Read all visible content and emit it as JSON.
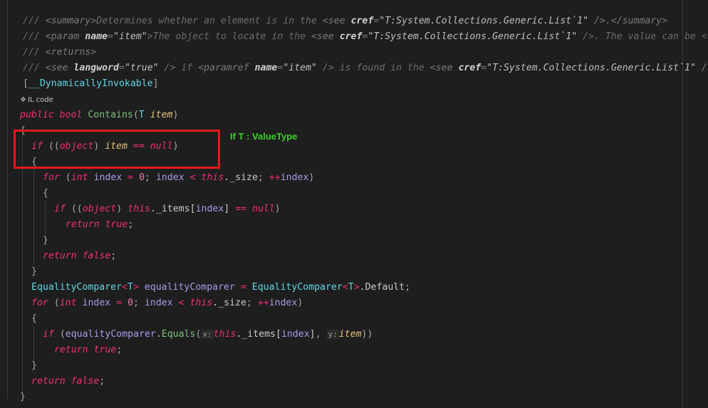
{
  "annotation": {
    "note": "If T : ValueType",
    "box_color": "#e3191b",
    "note_color": "#39d128"
  },
  "meta": {
    "icon": "il-code-icon",
    "label": "IL code"
  },
  "doc": {
    "l1": {
      "slash": "///",
      "open": "<summary>",
      "text": "Determines whether an element is in the ",
      "see": "<see ",
      "cref": "cref",
      "eq": "=",
      "val": "\"T:System.Collections.Generic.List`1\"",
      "close": " />.</summary>"
    },
    "l2": {
      "slash": "///",
      "open": "<param ",
      "name": "name",
      "eq": "=",
      "nameval": "\"item\"",
      "text1": ">The object to locate in the ",
      "see": "<see ",
      "cref": "cref",
      "eq2": "=",
      "val": "\"T:System.Collections.Generic.List`1\"",
      "text2": " />. The value can be <"
    },
    "l3": {
      "slash": "///",
      "open": "<returns>"
    },
    "l4": {
      "slash": "///",
      "see1": "<see ",
      "langword": "langword",
      "eq": "=",
      "langval": "\"true\"",
      "mid": " /> if ",
      "paramref": "<paramref ",
      "name": "name",
      "eq2": "=",
      "nameval": "\"item\"",
      "mid2": " /> is found in the ",
      "see2": "<see ",
      "cref": "cref",
      "eq3": "=",
      "val": "\"T:System.Collections.Generic.List`1\"",
      "end": " /"
    }
  },
  "code": {
    "attr": {
      "open": "[",
      "name": "__DynamicallyInvokable",
      "close": "]"
    },
    "sig": {
      "public": "public",
      "bool": "bool",
      "name": "Contains",
      "open": "(",
      "T": "T",
      "item": "item",
      "close": ")"
    },
    "brace_open": "{",
    "brace_close": "}",
    "if1": {
      "if": "if",
      "open": "((",
      "object": "object",
      "close": ")",
      "item": "item",
      "eq": "==",
      "null": "null",
      "end": ")"
    },
    "for1": {
      "for": "for",
      "open": "(",
      "int": "int",
      "index": "index",
      "assign": "=",
      "zero": "0",
      "semi": ";",
      "index2": "index",
      "lt": "<",
      "this": "this",
      "size": "._size",
      "semi2": ";",
      "inc": "++",
      "index3": "index",
      "close": ")"
    },
    "if2": {
      "if": "if",
      "open": "((",
      "object": "object",
      "close": ")",
      "this": "this",
      "items": "._items[",
      "index": "index",
      "bracket": "]",
      "eq": "==",
      "null": "null",
      "end": ")"
    },
    "ret_true": {
      "return": "return",
      "true": "true",
      "semi": ";"
    },
    "ret_false": {
      "return": "return",
      "false": "false",
      "semi": ";"
    },
    "ec": {
      "type": "EqualityComparer",
      "lt": "<",
      "T": "T",
      "gt": ">",
      "var": "equalityComparer",
      "assign": "=",
      "type2": "EqualityComparer",
      "lt2": "<",
      "T2": "T",
      "gt2": ">",
      "prop": ".Default",
      "semi": ";"
    },
    "if3": {
      "if": "if",
      "open": "(",
      "var": "equalityComparer",
      "dot": ".",
      "fn": "Equals",
      "paren": "(",
      "hint_x": "x:",
      "this": "this",
      "items": "._items[",
      "index": "index",
      "bracket": "]",
      "comma": ",",
      "hint_y": "y:",
      "item": "item",
      "close": "))"
    }
  }
}
